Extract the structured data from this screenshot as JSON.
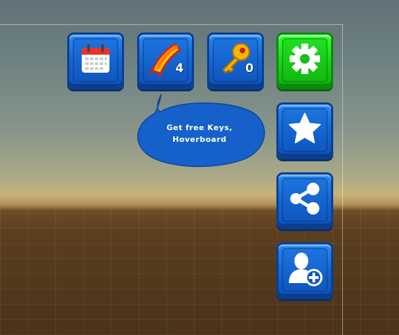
{
  "top_bar": {
    "calendar": {
      "icon": "calendar-icon"
    },
    "hoverboard": {
      "icon": "hoverboard-icon",
      "count": "4"
    },
    "keys": {
      "icon": "key-icon",
      "count": "0"
    },
    "settings": {
      "icon": "gear-icon"
    }
  },
  "tooltip": {
    "line1": "Get free Keys,",
    "line2": "Hoverboard"
  },
  "side_bar": {
    "favorites": {
      "icon": "star-icon"
    },
    "share": {
      "icon": "share-icon"
    },
    "add_friend": {
      "icon": "add-user-icon"
    }
  },
  "colors": {
    "button_blue": "#1468d8",
    "button_green": "#18d418",
    "bubble": "#1560c9"
  }
}
